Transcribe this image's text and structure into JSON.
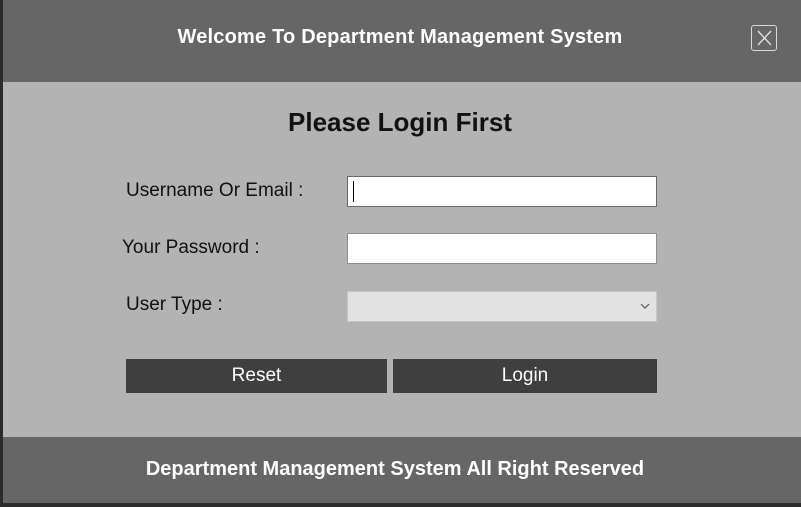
{
  "header": {
    "title": "Welcome To Department Management System",
    "close_icon": "close-icon"
  },
  "form": {
    "heading": "Please Login First",
    "username_label": "Username Or Email :",
    "username_value": "",
    "password_label": "Your Password :",
    "password_value": "",
    "user_type_label": "User Type :",
    "user_type_selected": "",
    "reset_label": "Reset",
    "login_label": "Login"
  },
  "footer": {
    "text": "Department Management System All Right Reserved"
  },
  "colors": {
    "titlebar": "#666666",
    "body": "#b3b3b3",
    "button": "#3f3f3f",
    "select_bg": "#e2e2e2"
  }
}
